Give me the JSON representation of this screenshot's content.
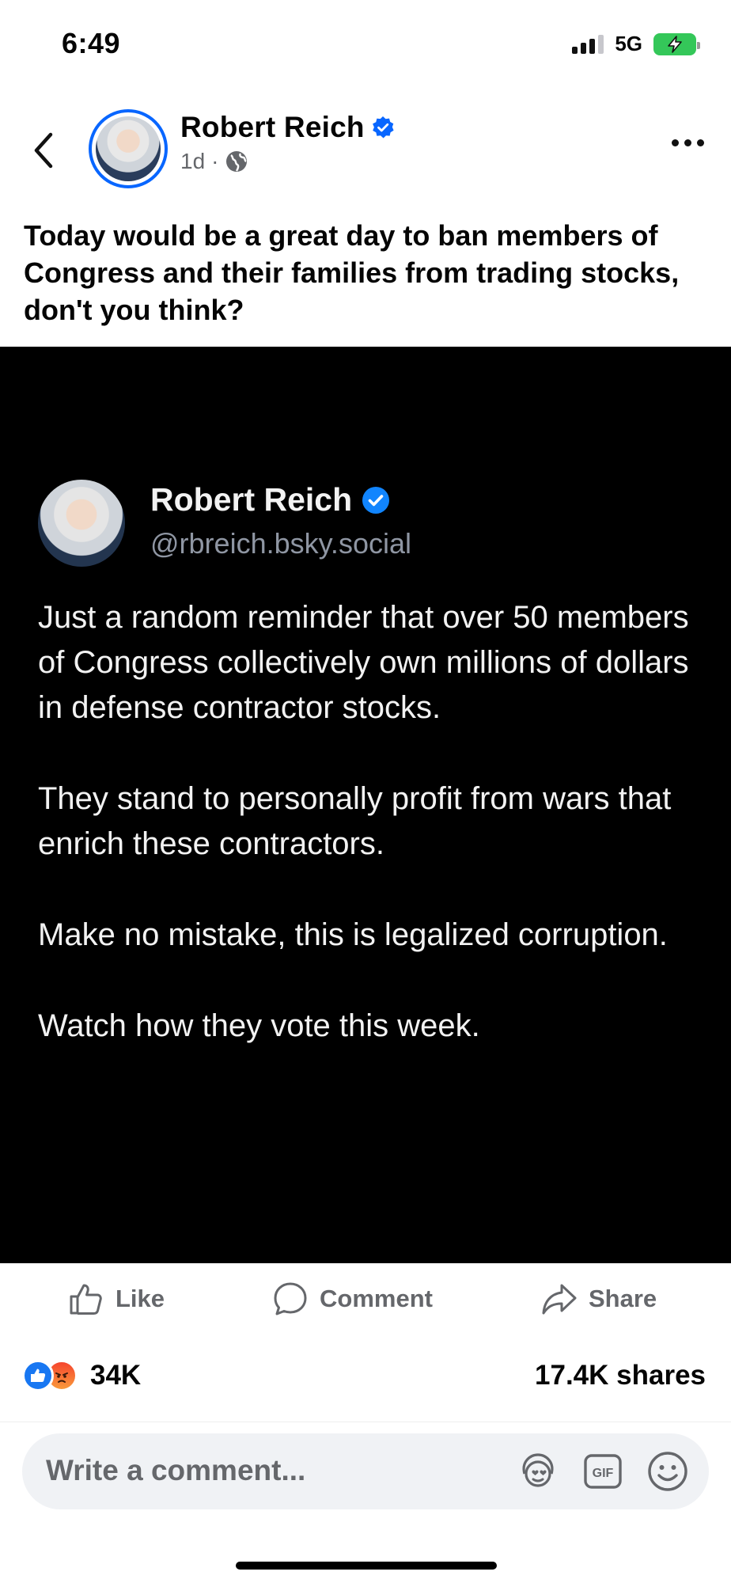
{
  "status_bar": {
    "time": "6:49",
    "network": "5G"
  },
  "post": {
    "author": "Robert Reich",
    "timestamp": "1d",
    "separator": "·",
    "text": "Today would be a great day to ban members of Congress and their families from trading stocks, don't you think?"
  },
  "embed": {
    "name": "Robert Reich",
    "handle": "@rbreich.bsky.social",
    "paragraphs": [
      "Just a random reminder that over 50 members of Congress collectively own millions of dollars in defense contractor stocks.",
      "They stand to personally profit from wars that enrich these contractors.",
      "Make no mistake, this is legalized corruption.",
      "Watch how they vote this week."
    ]
  },
  "actions": {
    "like": "Like",
    "comment": "Comment",
    "share": "Share"
  },
  "stats": {
    "reactions": "34K",
    "shares": "17.4K shares"
  },
  "comment_input": {
    "placeholder": "Write a comment..."
  },
  "colors": {
    "brand_blue": "#0866ff",
    "embed_bg": "#000000",
    "muted": "#65676b"
  }
}
